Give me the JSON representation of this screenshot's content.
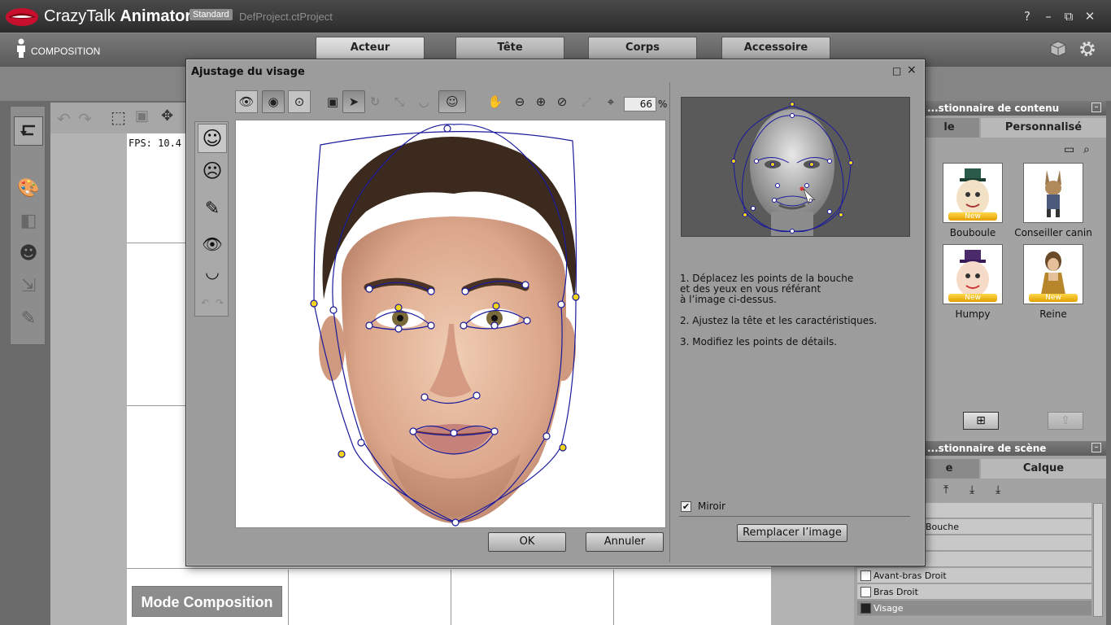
{
  "app": {
    "name_light": "CrazyTalk",
    "name_bold": "Animator",
    "edition": "Standard",
    "project": "DefProject.ctProject",
    "controls": {
      "help": "?",
      "minimize": "–",
      "restore": "⧉",
      "close": "✕"
    }
  },
  "modebar": {
    "composition": "COMPOSITION",
    "tabs": [
      {
        "label": "Acteur",
        "active": true
      },
      {
        "label": "Tête"
      },
      {
        "label": "Corps"
      },
      {
        "label": "Accessoire"
      }
    ]
  },
  "viewport": {
    "fps": "FPS: 10.4",
    "mode_button": "Mode Composition"
  },
  "content_manager": {
    "title": "...stionnaire de contenu",
    "tab_left": "le",
    "tab_right": "Personnalisé",
    "items": [
      {
        "label": "Bouboule",
        "badge": "New"
      },
      {
        "label": "Conseiller canin",
        "badge": ""
      },
      {
        "label": "Humpy",
        "badge": "New"
      },
      {
        "label": "Reine",
        "badge": "New"
      }
    ]
  },
  "scene_manager": {
    "title": "...stionnaire de scène",
    "tab_left": "e",
    "tab_right": "Calque",
    "rows": [
      {
        "label": ""
      },
      {
        "label": "Bouche"
      },
      {
        "label": ""
      },
      {
        "label": ""
      },
      {
        "label": "Avant-bras Droit"
      },
      {
        "label": "Bras Droit"
      },
      {
        "label": "Visage",
        "selected": true
      }
    ]
  },
  "dialog": {
    "title": "Ajustage du visage",
    "zoom": "66",
    "zoom_unit": "%",
    "instructions": [
      "1. Déplacez les points de la bouche\net des yeux en vous référant\nà l’image ci-dessus.",
      "2. Ajustez la tête et les caractéristiques.",
      "3. Modifiez les points de détails."
    ],
    "mirror_label": "Miroir",
    "mirror_checked": true,
    "replace_button": "Remplacer l’image",
    "ok_button": "OK",
    "cancel_button": "Annuler"
  },
  "colors": {
    "accent_yellow": "#f2d41a",
    "contour_blue": "#1a1a9c",
    "lips_red": "#c8102e"
  }
}
